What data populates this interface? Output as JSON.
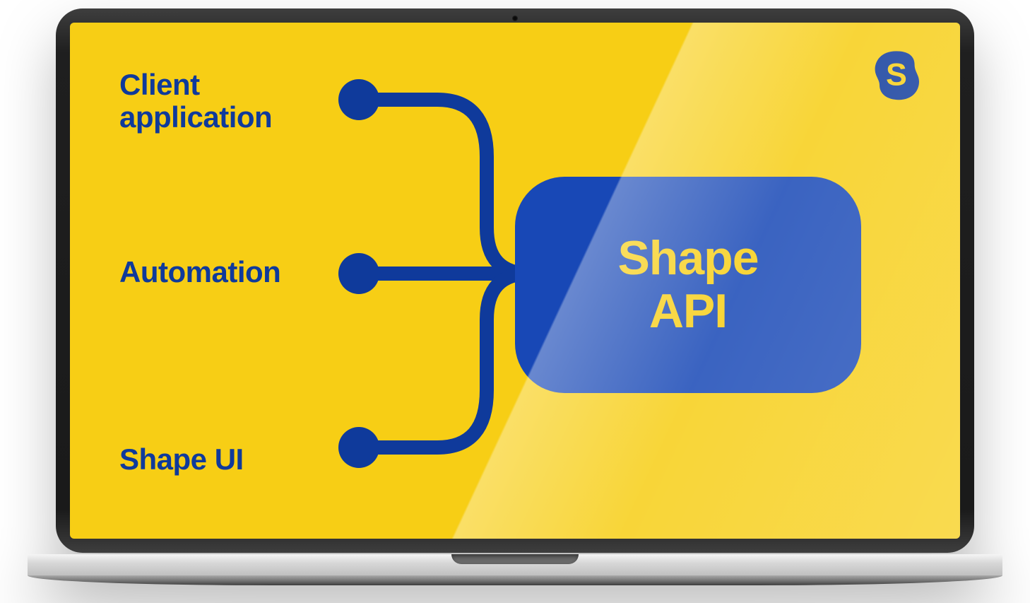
{
  "diagram": {
    "nodes": {
      "client_application": "Client application",
      "automation": "Automation",
      "shape_ui": "Shape UI"
    },
    "hub": {
      "line1": "Shape",
      "line2": "API"
    },
    "logo_letter": "S"
  },
  "colors": {
    "background": "#F7CE15",
    "primary": "#0F3A9B",
    "hub": "#1848B6",
    "hub_text": "#F7CE15"
  }
}
